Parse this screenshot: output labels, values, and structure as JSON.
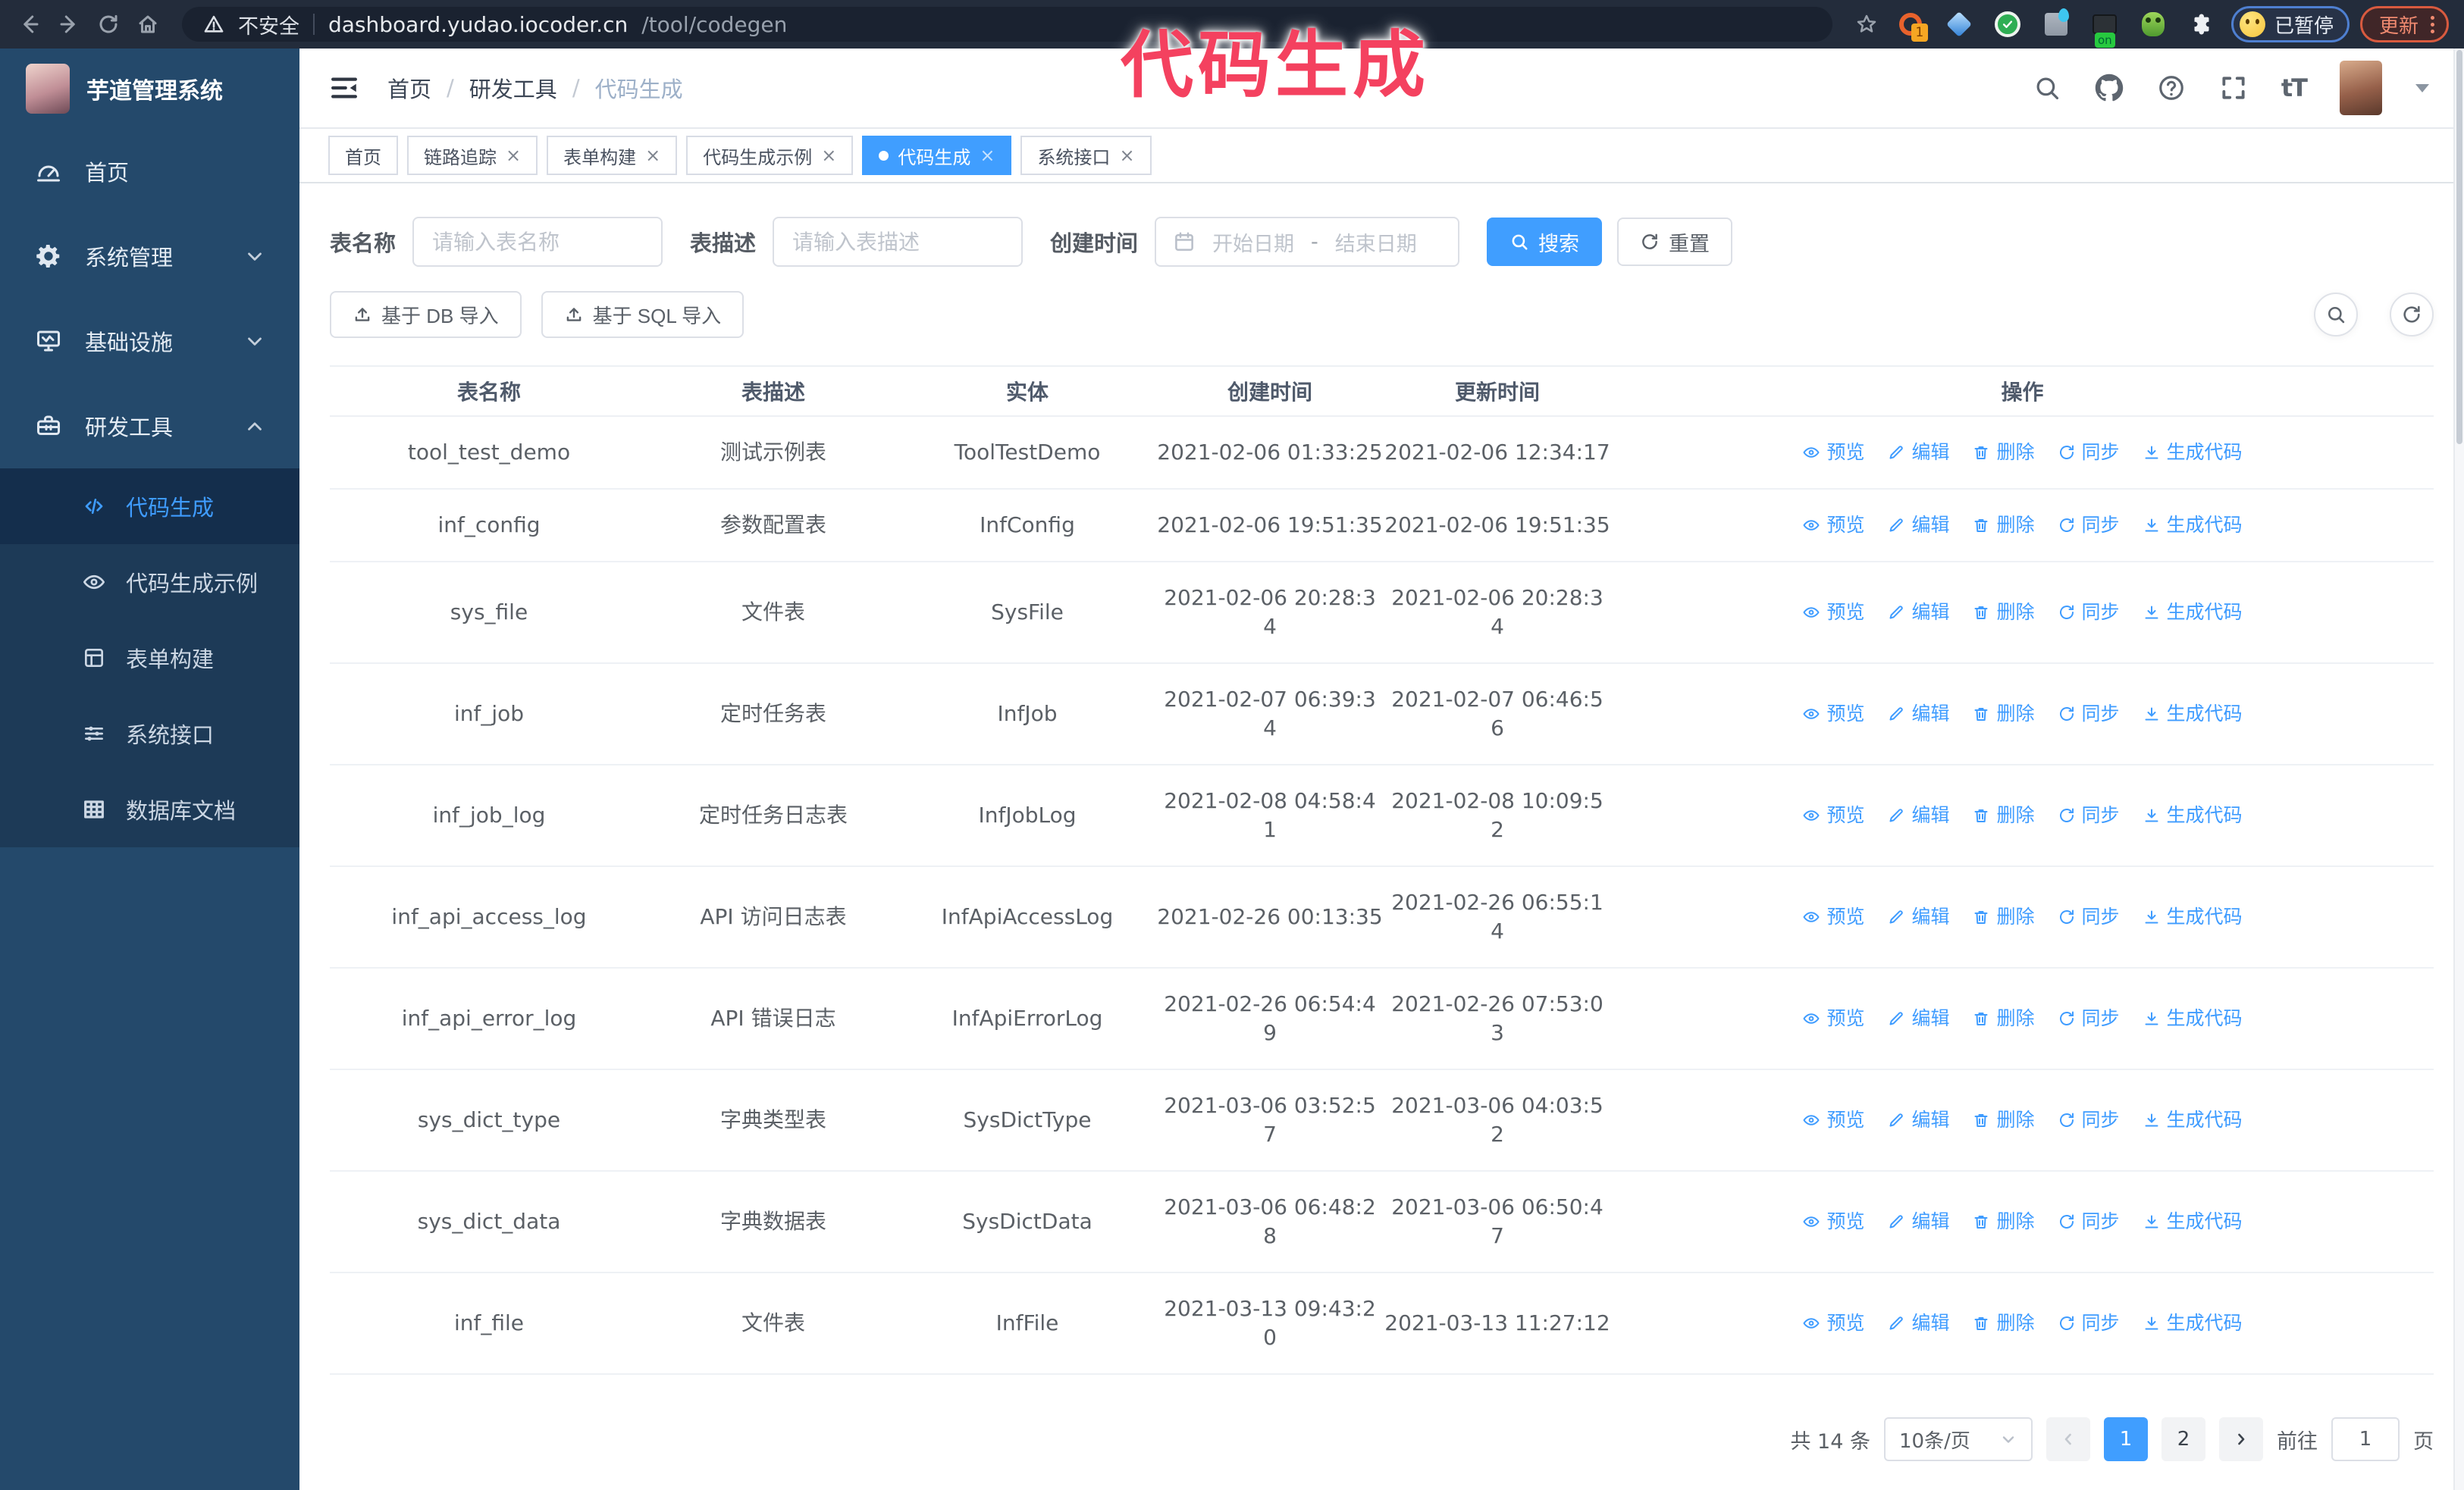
{
  "colors": {
    "accent": "#409eff",
    "annotation": "#f4415f",
    "sidebar_bg": "#24496b",
    "submenu_bg": "#1d3a57",
    "browser_bar_bg": "#232c3b",
    "update_accent": "#d85a3f",
    "paused_border": "#4e7fd0"
  },
  "annotation": {
    "text": "代码生成"
  },
  "browser": {
    "security_label": "不安全",
    "url_host": "dashboard.yudao.iocoder.cn",
    "url_path": "/tool/codegen",
    "ext_badge": "1",
    "on_badge": "on",
    "profile_label": "已暂停",
    "update_label": "更新"
  },
  "ui": {
    "close_glyph": "×",
    "breadcrumb_separator": "/",
    "font_size_glyph": "tT"
  },
  "sidebar": {
    "logo_title": "芋道管理系统",
    "items": [
      {
        "label": "首页",
        "icon": "dashboard-icon"
      },
      {
        "label": "系统管理",
        "icon": "gear-icon"
      },
      {
        "label": "基础设施",
        "icon": "monitor-icon"
      },
      {
        "label": "研发工具",
        "icon": "toolbox-icon"
      }
    ],
    "submenu": [
      {
        "label": "代码生成",
        "icon": "code-icon",
        "active": true
      },
      {
        "label": "代码生成示例",
        "icon": "example-icon"
      },
      {
        "label": "表单构建",
        "icon": "form-icon"
      },
      {
        "label": "系统接口",
        "icon": "api-icon"
      },
      {
        "label": "数据库文档",
        "icon": "db-doc-icon"
      }
    ]
  },
  "header": {
    "breadcrumb": [
      "首页",
      "研发工具",
      "代码生成"
    ]
  },
  "tabs": [
    {
      "label": "首页",
      "closable": false
    },
    {
      "label": "链路追踪",
      "closable": true
    },
    {
      "label": "表单构建",
      "closable": true
    },
    {
      "label": "代码生成示例",
      "closable": true
    },
    {
      "label": "代码生成",
      "closable": true,
      "active": true
    },
    {
      "label": "系统接口",
      "closable": true
    }
  ],
  "filters": {
    "name_label": "表名称",
    "name_placeholder": "请输入表名称",
    "desc_label": "表描述",
    "desc_placeholder": "请输入表描述",
    "time_label": "创建时间",
    "start_placeholder": "开始日期",
    "range_separator": "-",
    "end_placeholder": "结束日期",
    "search_label": "搜索",
    "reset_label": "重置"
  },
  "toolbar": {
    "import_db_label": "基于 DB 导入",
    "import_sql_label": "基于 SQL 导入"
  },
  "table": {
    "columns": [
      "表名称",
      "表描述",
      "实体",
      "创建时间",
      "更新时间",
      "操作"
    ],
    "actions": [
      "预览",
      "编辑",
      "删除",
      "同步",
      "生成代码"
    ],
    "rows": [
      {
        "name": "tool_test_demo",
        "desc": "测试示例表",
        "entity": "ToolTestDemo",
        "created": "2021-02-06 01:33:25",
        "updated": "2021-02-06 12:34:17"
      },
      {
        "name": "inf_config",
        "desc": "参数配置表",
        "entity": "InfConfig",
        "created": "2021-02-06 19:51:35",
        "updated": "2021-02-06 19:51:35"
      },
      {
        "name": "sys_file",
        "desc": "文件表",
        "entity": "SysFile",
        "created": "2021-02-06 20:28:3\n4",
        "updated": "2021-02-06 20:28:3\n4"
      },
      {
        "name": "inf_job",
        "desc": "定时任务表",
        "entity": "InfJob",
        "created": "2021-02-07 06:39:3\n4",
        "updated": "2021-02-07 06:46:5\n6"
      },
      {
        "name": "inf_job_log",
        "desc": "定时任务日志表",
        "entity": "InfJobLog",
        "created": "2021-02-08 04:58:4\n1",
        "updated": "2021-02-08 10:09:5\n2"
      },
      {
        "name": "inf_api_access_log",
        "desc": "API 访问日志表",
        "entity": "InfApiAccessLog",
        "created": "2021-02-26 00:13:35",
        "updated": "2021-02-26 06:55:1\n4"
      },
      {
        "name": "inf_api_error_log",
        "desc": "API 错误日志",
        "entity": "InfApiErrorLog",
        "created": "2021-02-26 06:54:4\n9",
        "updated": "2021-02-26 07:53:0\n3"
      },
      {
        "name": "sys_dict_type",
        "desc": "字典类型表",
        "entity": "SysDictType",
        "created": "2021-03-06 03:52:5\n7",
        "updated": "2021-03-06 04:03:5\n2"
      },
      {
        "name": "sys_dict_data",
        "desc": "字典数据表",
        "entity": "SysDictData",
        "created": "2021-03-06 06:48:2\n8",
        "updated": "2021-03-06 06:50:4\n7"
      },
      {
        "name": "inf_file",
        "desc": "文件表",
        "entity": "InfFile",
        "created": "2021-03-13 09:43:2\n0",
        "updated": "2021-03-13 11:27:12"
      }
    ]
  },
  "pagination": {
    "total_label": "共 14 条",
    "page_size_label": "10条/页",
    "pages": [
      "1",
      "2"
    ],
    "active_page": "1",
    "goto_label": "前往",
    "goto_value": "1",
    "page_unit_label": "页"
  }
}
